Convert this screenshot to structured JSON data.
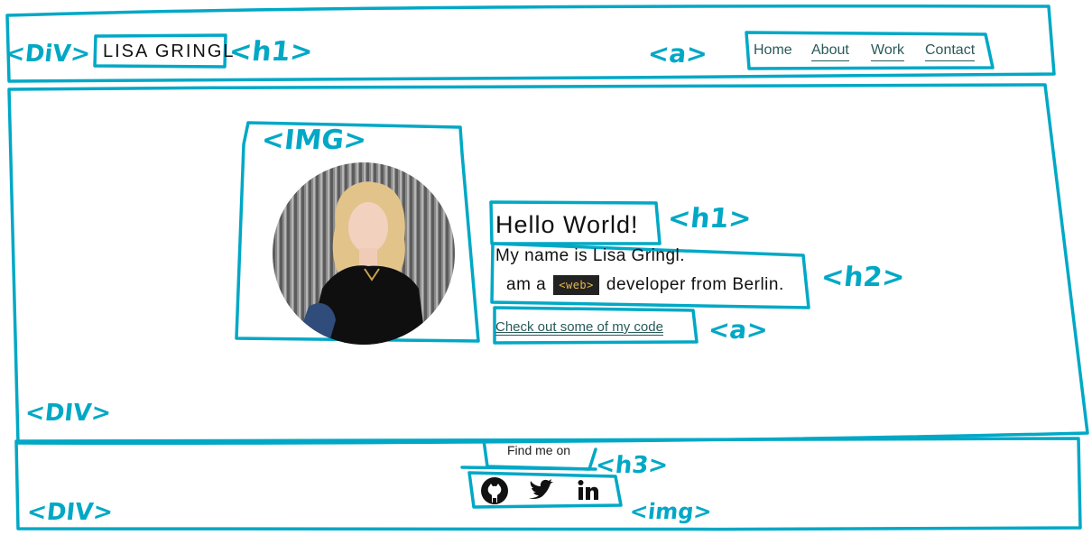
{
  "header": {
    "logo": "LISA GRINGL",
    "nav": [
      "Home",
      "About",
      "Work",
      "Contact"
    ]
  },
  "hero": {
    "title": "Hello World!",
    "line1": "My name is Lisa Gringl.",
    "line2_prefix": "am a",
    "chip": "<web>",
    "line2_suffix": "developer from Berlin.",
    "code_link": "Check out some of my code"
  },
  "footer": {
    "find_me": "Find me on",
    "social_icons": [
      "github-icon",
      "twitter-icon",
      "linkedin-icon"
    ]
  },
  "annotations": {
    "div_header": "<DiV>",
    "h1_logo": "<h1>",
    "a_nav": "<a>",
    "img": "<IMG>",
    "h1_hero": "<h1>",
    "h2": "<h2>",
    "a_link": "<a>",
    "div_main": "<DIV>",
    "h3": "<h3>",
    "div_footer": "<DIV>",
    "img_social": "<img>"
  },
  "colors": {
    "sketch": "#00a8c6",
    "link": "#2a5a5a",
    "chip_bg": "#222222",
    "chip_text": "#e6b650"
  }
}
